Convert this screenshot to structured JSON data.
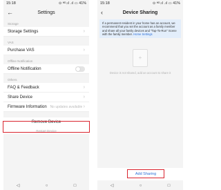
{
  "left": {
    "status": {
      "time": "15:18",
      "extra": "—",
      "icons": "⊙ ᴴᴰ.ıl .ıl ▭ 41%"
    },
    "title": "Settings",
    "sections": {
      "storage": {
        "label": "Storage",
        "row": "Storage Settings"
      },
      "vas": {
        "label": "VAS",
        "row": "Purchase VAS"
      },
      "offline": {
        "label": "Offline Notification",
        "row": "Offline Notification"
      },
      "others": {
        "label": "Others",
        "faq": "FAQ & Feedback",
        "share": "Share Device",
        "firmware": "Firmware Information",
        "firmware_value": "No updates available"
      }
    },
    "remove": "Remove Device",
    "restart": "Restart Device"
  },
  "right": {
    "status": {
      "time": "15:18",
      "extra": "—",
      "icons": "⊙ ᴴᴰ.ıl .ıl ▭ 41%"
    },
    "title": "Device Sharing",
    "info_text": "If a permanent resident in your home has an account, we recommend that you set the account as a family member and share all your family devices and \"Tap-To-Run\" Scene with the family member.",
    "info_link": "Home Settings",
    "empty_text": "Device is not shared, add an account to share it",
    "add_button": "Add Sharing"
  },
  "nav": {
    "back": "◁",
    "home": "○",
    "recent": "□"
  },
  "colors": {
    "highlight": "#d9232d",
    "link": "#2e6fd6",
    "info_bg": "#e3eefb"
  }
}
